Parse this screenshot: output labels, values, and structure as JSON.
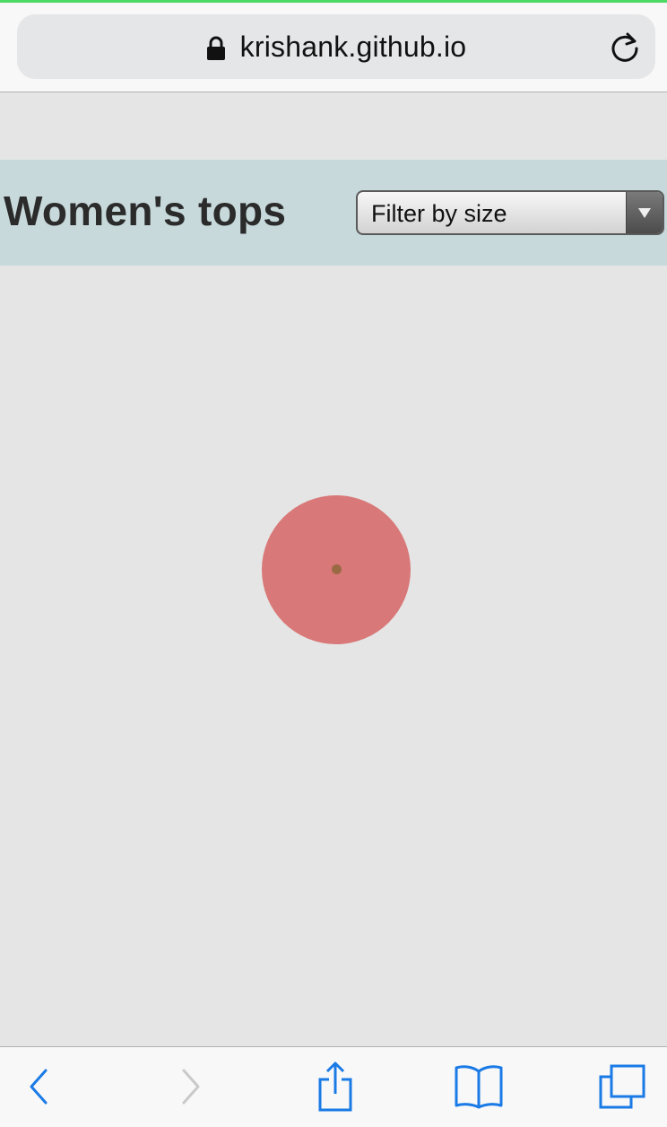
{
  "browser": {
    "url": "krishank.github.io",
    "icons": {
      "lock": "lock-icon",
      "reload": "reload-icon",
      "back": "back-icon",
      "forward": "forward-icon",
      "share": "share-icon",
      "bookmarks": "bookmarks-icon",
      "tabs": "tabs-icon"
    },
    "accent_color": "#1a7ae6",
    "disabled_color": "#c9c9c9",
    "load_progress": 1.0
  },
  "header": {
    "title": "Women's tops",
    "filter_select": {
      "selected": "Filter by size"
    }
  },
  "main": {
    "loading_indicator": {
      "color": "#d97878",
      "dot_color": "#9a6a45"
    }
  }
}
